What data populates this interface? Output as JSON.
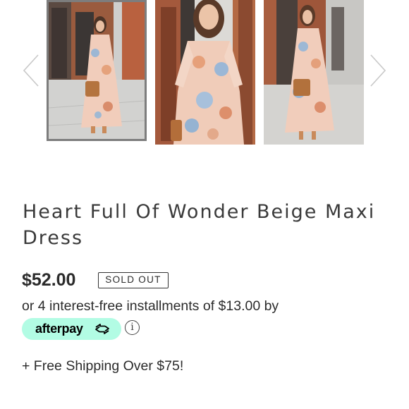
{
  "product": {
    "title": "Heart Full Of Wonder Beige Maxi Dress",
    "price": "$52.00",
    "status_badge": "SOLD OUT",
    "installments_text": "or 4 interest-free installments of $13.00 by",
    "afterpay_label": "afterpay",
    "info_symbol": "i",
    "shipping_text": "+ Free Shipping Over $75!"
  },
  "gallery": {
    "selected_index": 0,
    "icons": [
      "chevron-left-icon",
      "chevron-right-icon"
    ]
  },
  "colors": {
    "afterpay_mint": "#b2fce4",
    "text": "#2b2b2b",
    "selected_border": "#7d7d7d"
  }
}
